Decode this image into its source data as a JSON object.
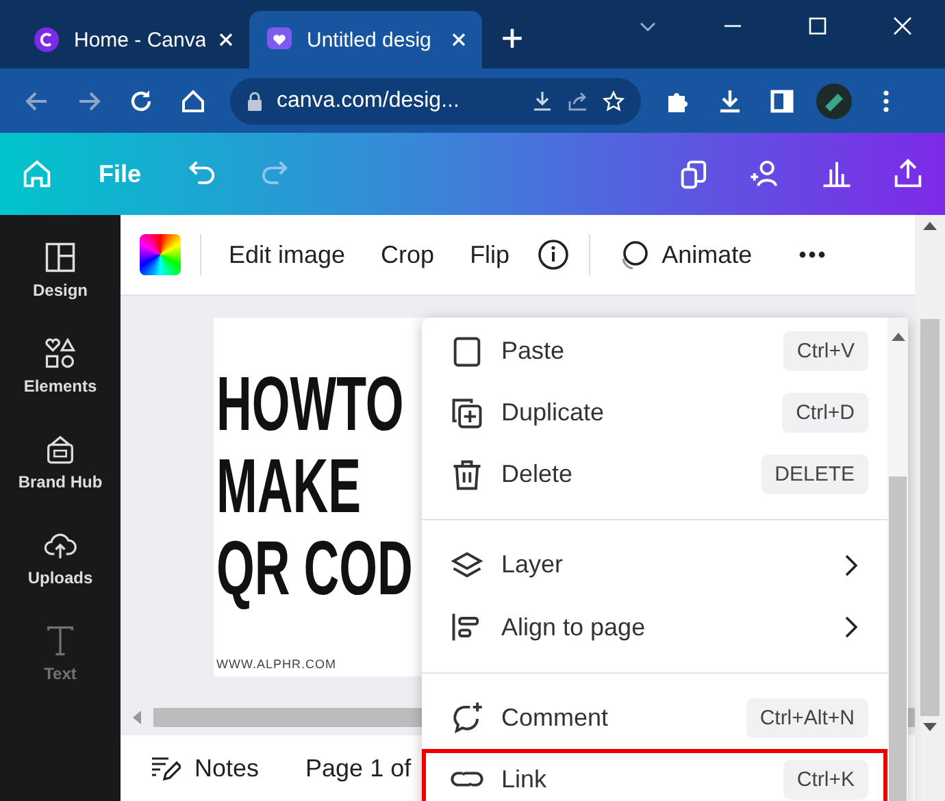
{
  "browser": {
    "tabs": [
      {
        "title": "Home - Canva",
        "selected": false
      },
      {
        "title": "Untitled desig",
        "selected": true
      }
    ],
    "address": "canva.com/desig..."
  },
  "header": {
    "file": "File"
  },
  "sidebar": {
    "items": [
      {
        "kind": "design",
        "label": "Design"
      },
      {
        "kind": "elements",
        "label": "Elements"
      },
      {
        "kind": "brand",
        "label": "Brand Hub"
      },
      {
        "kind": "uploads",
        "label": "Uploads"
      },
      {
        "kind": "text",
        "label": "Text"
      }
    ]
  },
  "toolbar": {
    "actions": [
      "Edit image",
      "Crop",
      "Flip"
    ],
    "animate": "Animate"
  },
  "design": {
    "lines": [
      "HOWTO",
      "MAKE",
      "QR COD"
    ],
    "footer": "WWW.ALPHR.COM"
  },
  "bottom_bar": {
    "notes": "Notes",
    "page": "Page 1 of"
  },
  "context_menu": {
    "items": [
      {
        "kind": "paste",
        "label": "Paste",
        "shortcut": "Ctrl+V",
        "submenu": false,
        "highlighted": false
      },
      {
        "kind": "duplicate",
        "label": "Duplicate",
        "shortcut": "Ctrl+D",
        "submenu": false,
        "highlighted": false
      },
      {
        "kind": "delete",
        "label": "Delete",
        "shortcut": "DELETE",
        "submenu": false,
        "highlighted": false
      },
      {
        "kind": "divider"
      },
      {
        "kind": "layer",
        "label": "Layer",
        "submenu": true,
        "highlighted": false
      },
      {
        "kind": "align",
        "label": "Align to page",
        "submenu": true,
        "highlighted": false
      },
      {
        "kind": "divider"
      },
      {
        "kind": "comment",
        "label": "Comment",
        "shortcut": "Ctrl+Alt+N",
        "submenu": false,
        "highlighted": false
      },
      {
        "kind": "link",
        "label": "Link",
        "shortcut": "Ctrl+K",
        "submenu": false,
        "highlighted": true
      }
    ]
  }
}
